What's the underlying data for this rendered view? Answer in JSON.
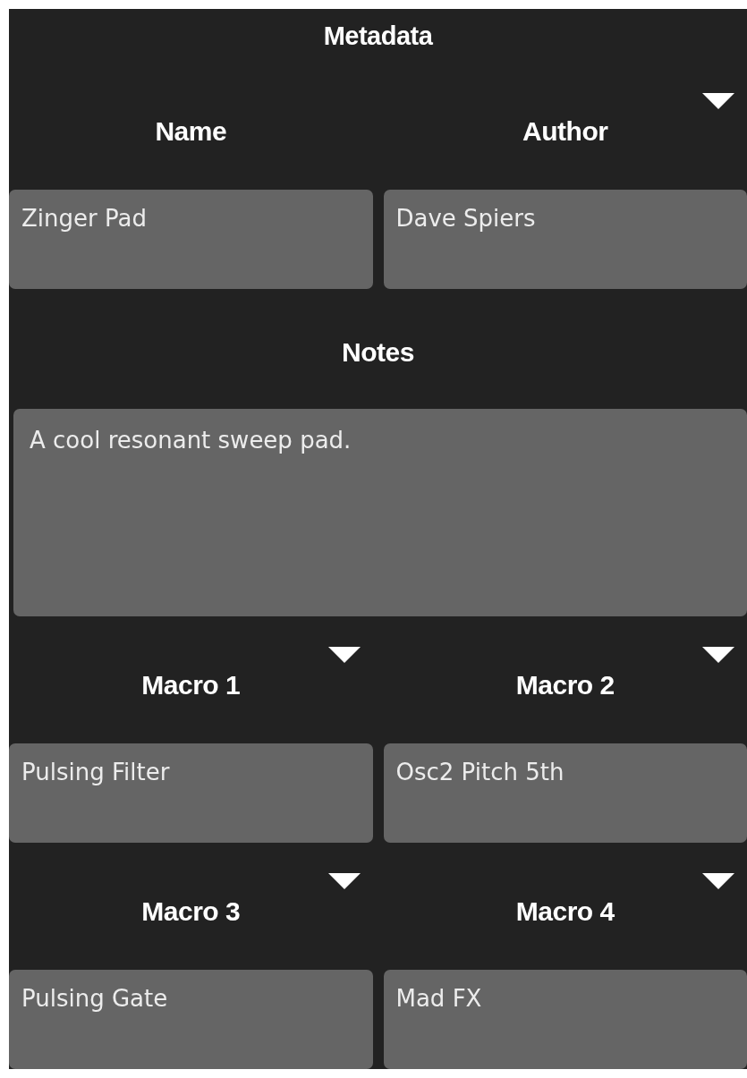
{
  "title": "Metadata",
  "rows": [
    {
      "kind": "pair",
      "fields": [
        {
          "label": "Name",
          "value": "Zinger Pad",
          "caret": false
        },
        {
          "label": "Author",
          "value": "Dave Spiers",
          "caret": true
        }
      ]
    },
    {
      "kind": "notes",
      "fields": [
        {
          "label": "Notes",
          "value": "A cool resonant sweep pad.",
          "caret": false
        }
      ]
    },
    {
      "kind": "pair",
      "fields": [
        {
          "label": "Macro 1",
          "value": "Pulsing Filter",
          "caret": true
        },
        {
          "label": "Macro 2",
          "value": "Osc2 Pitch 5th",
          "caret": true
        }
      ]
    },
    {
      "kind": "pair",
      "fields": [
        {
          "label": "Macro 3",
          "value": "Pulsing Gate",
          "caret": true
        },
        {
          "label": "Macro 4",
          "value": "Mad FX",
          "caret": true
        }
      ]
    }
  ]
}
